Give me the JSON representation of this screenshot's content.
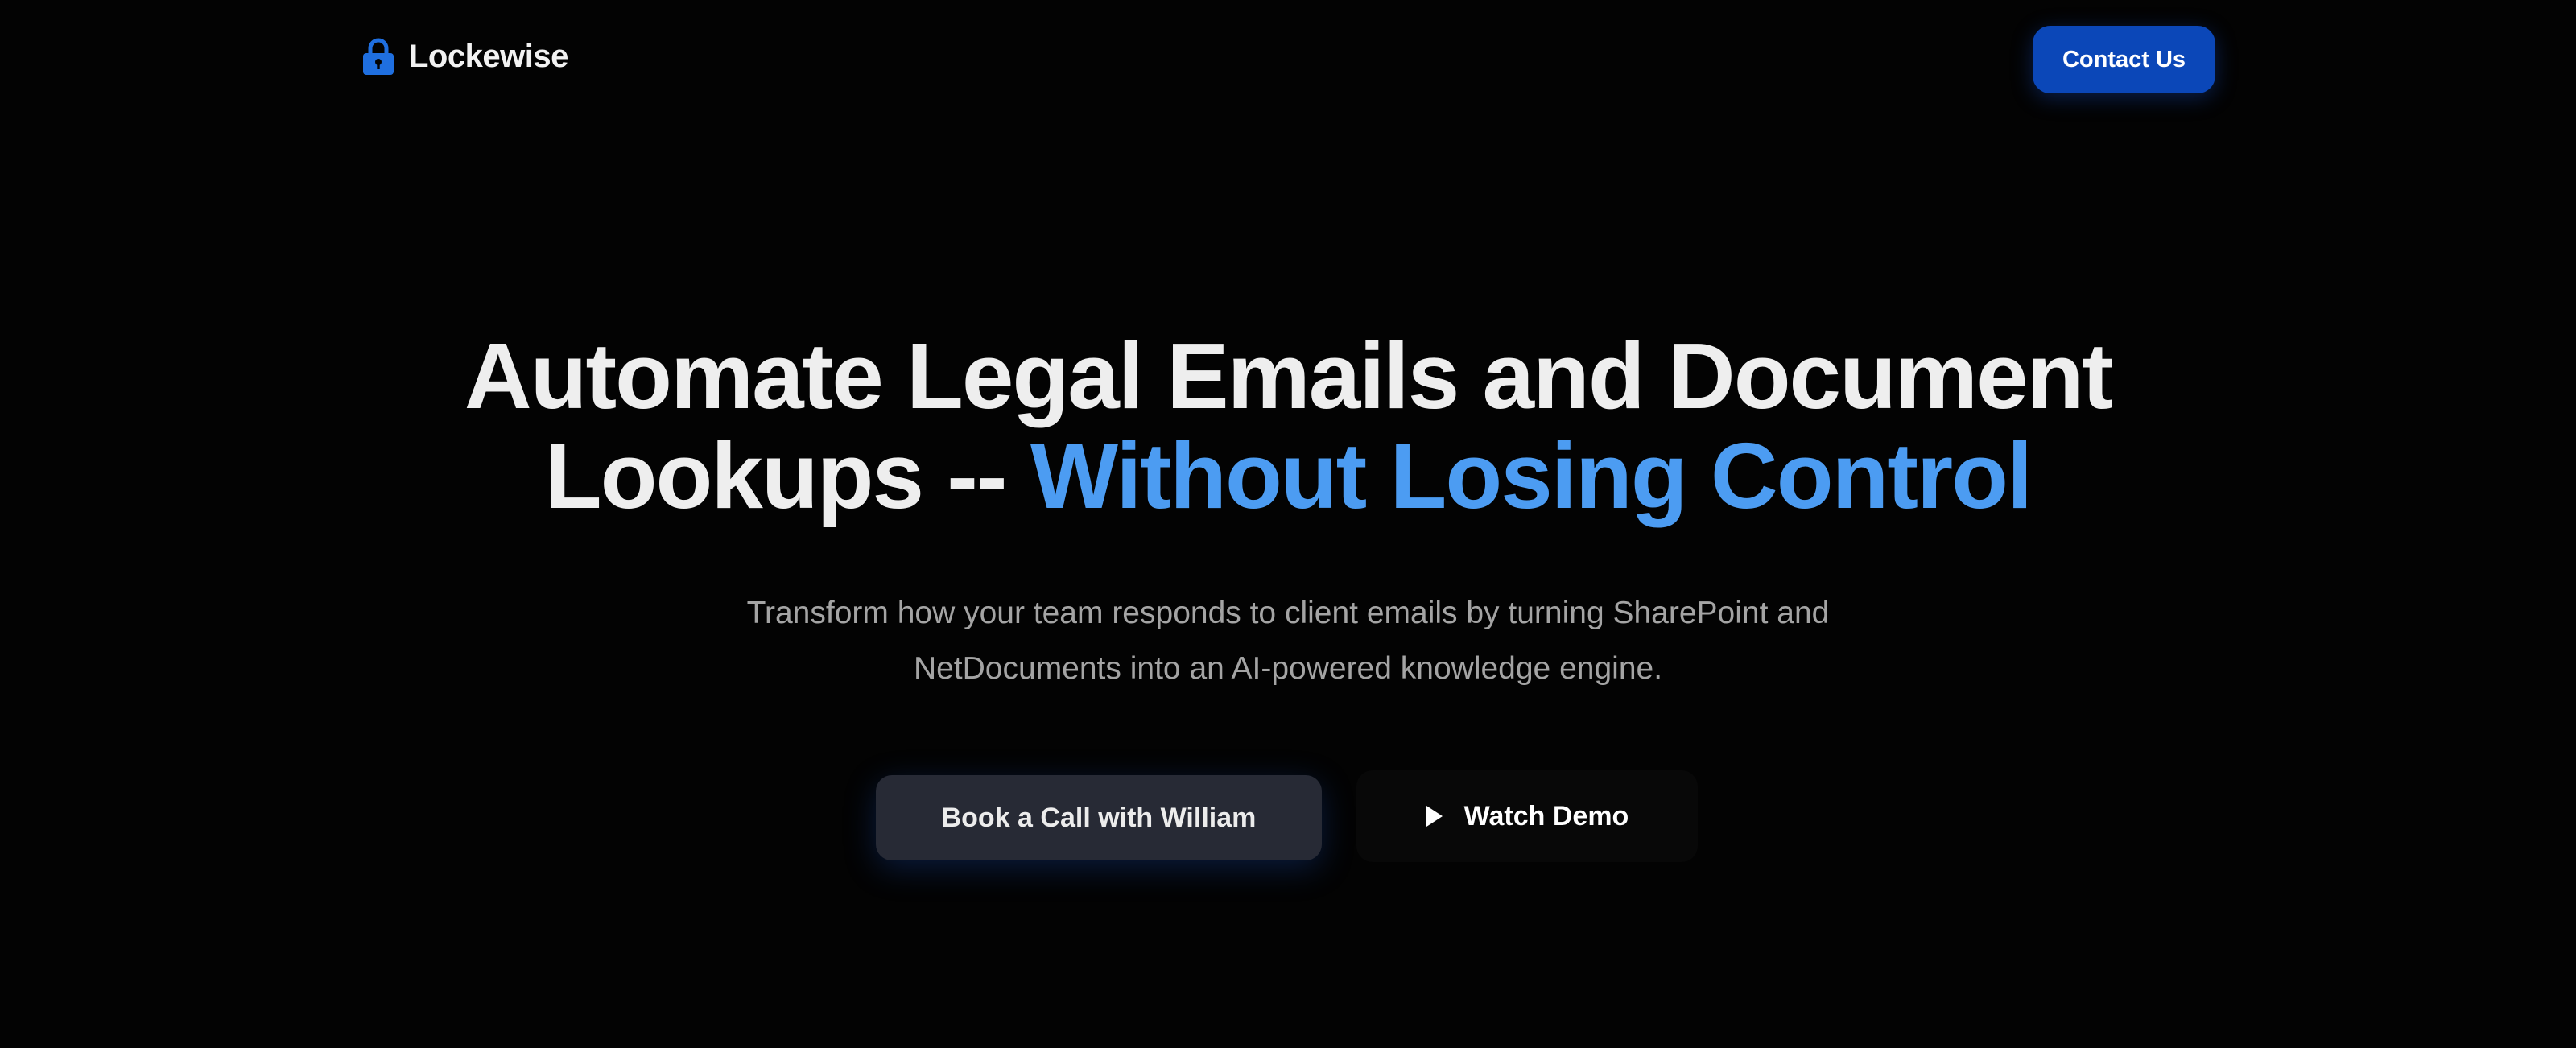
{
  "header": {
    "brand_name": "Lockewise",
    "brand_icon": "lock-icon",
    "contact_label": "Contact Us"
  },
  "hero": {
    "title_line1": "Automate Legal Emails and Document",
    "title_line2_plain": "Lookups -- ",
    "title_line2_accent": "Without Losing Control",
    "subtitle_line1": "Transform how your team responds to client emails by turning SharePoint and",
    "subtitle_line2": "NetDocuments into an AI-powered knowledge engine.",
    "book_call_label": "Book a Call with William",
    "watch_demo_label": "Watch Demo",
    "watch_demo_icon": "play-icon"
  },
  "colors": {
    "background": "#030303",
    "accent": "#4c9cf2",
    "brand_blue": "#0b47b8",
    "secondary_button": "#272a35"
  }
}
